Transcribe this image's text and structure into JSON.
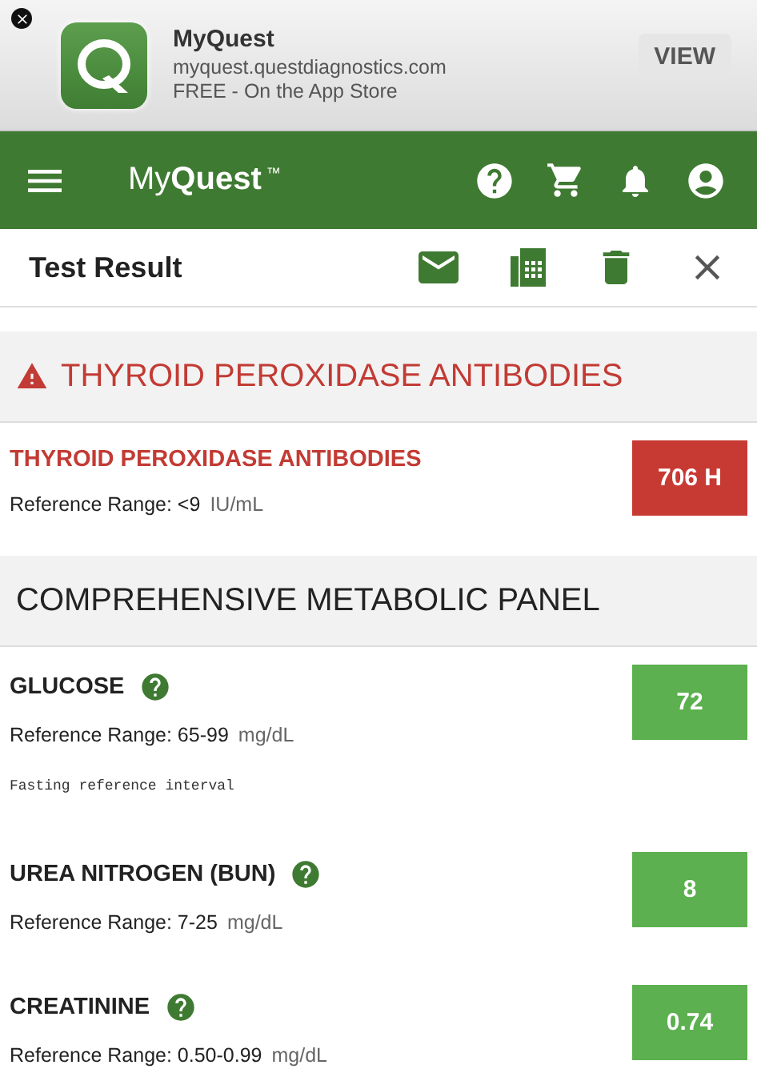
{
  "app_banner": {
    "title": "MyQuest",
    "url": "myquest.questdiagnostics.com",
    "subtitle": "FREE - On the App Store",
    "action": "VIEW"
  },
  "nav": {
    "brand_light": "My",
    "brand_bold": "Quest",
    "trademark": "™"
  },
  "header": {
    "title": "Test Result"
  },
  "sections": [
    {
      "title": "THYROID PEROXIDASE ANTIBODIES",
      "alert": true,
      "results": [
        {
          "name": "THYROID PEROXIDASE ANTIBODIES",
          "help": false,
          "high": true,
          "value": "706 H",
          "reference": "Reference Range: <9",
          "unit": "IU/mL"
        }
      ]
    },
    {
      "title": "COMPREHENSIVE METABOLIC PANEL",
      "alert": false,
      "results": [
        {
          "name": "GLUCOSE",
          "help": true,
          "high": false,
          "value": "72",
          "reference": "Reference Range: 65-99",
          "unit": "mg/dL",
          "note": "Fasting reference interval"
        },
        {
          "name": "UREA NITROGEN (BUN)",
          "help": true,
          "high": false,
          "value": "8",
          "reference": "Reference Range: 7-25",
          "unit": "mg/dL"
        },
        {
          "name": "CREATININE",
          "help": true,
          "high": false,
          "value": "0.74",
          "reference": "Reference Range: 0.50-0.99",
          "unit": "mg/dL"
        }
      ]
    }
  ]
}
